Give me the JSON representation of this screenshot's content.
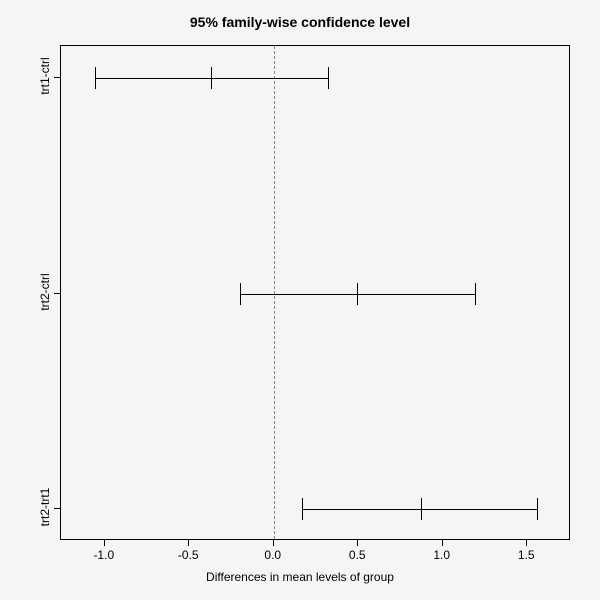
{
  "chart_data": {
    "type": "interval",
    "title": "95% family-wise confidence level",
    "xlabel": "Differences in mean levels of group",
    "ylabel": "",
    "xlim": [
      -1.2,
      1.7
    ],
    "x_ticks": [
      -1.0,
      -0.5,
      0.0,
      0.5,
      1.0,
      1.5
    ],
    "reference_line": 0.0,
    "comparisons": [
      {
        "label": "trt1-ctrl",
        "lower": -1.06,
        "estimate": -0.37,
        "upper": 0.32
      },
      {
        "label": "trt2-ctrl",
        "lower": -0.2,
        "estimate": 0.49,
        "upper": 1.19
      },
      {
        "label": "trt2-trt1",
        "lower": 0.17,
        "estimate": 0.87,
        "upper": 1.56
      }
    ]
  }
}
